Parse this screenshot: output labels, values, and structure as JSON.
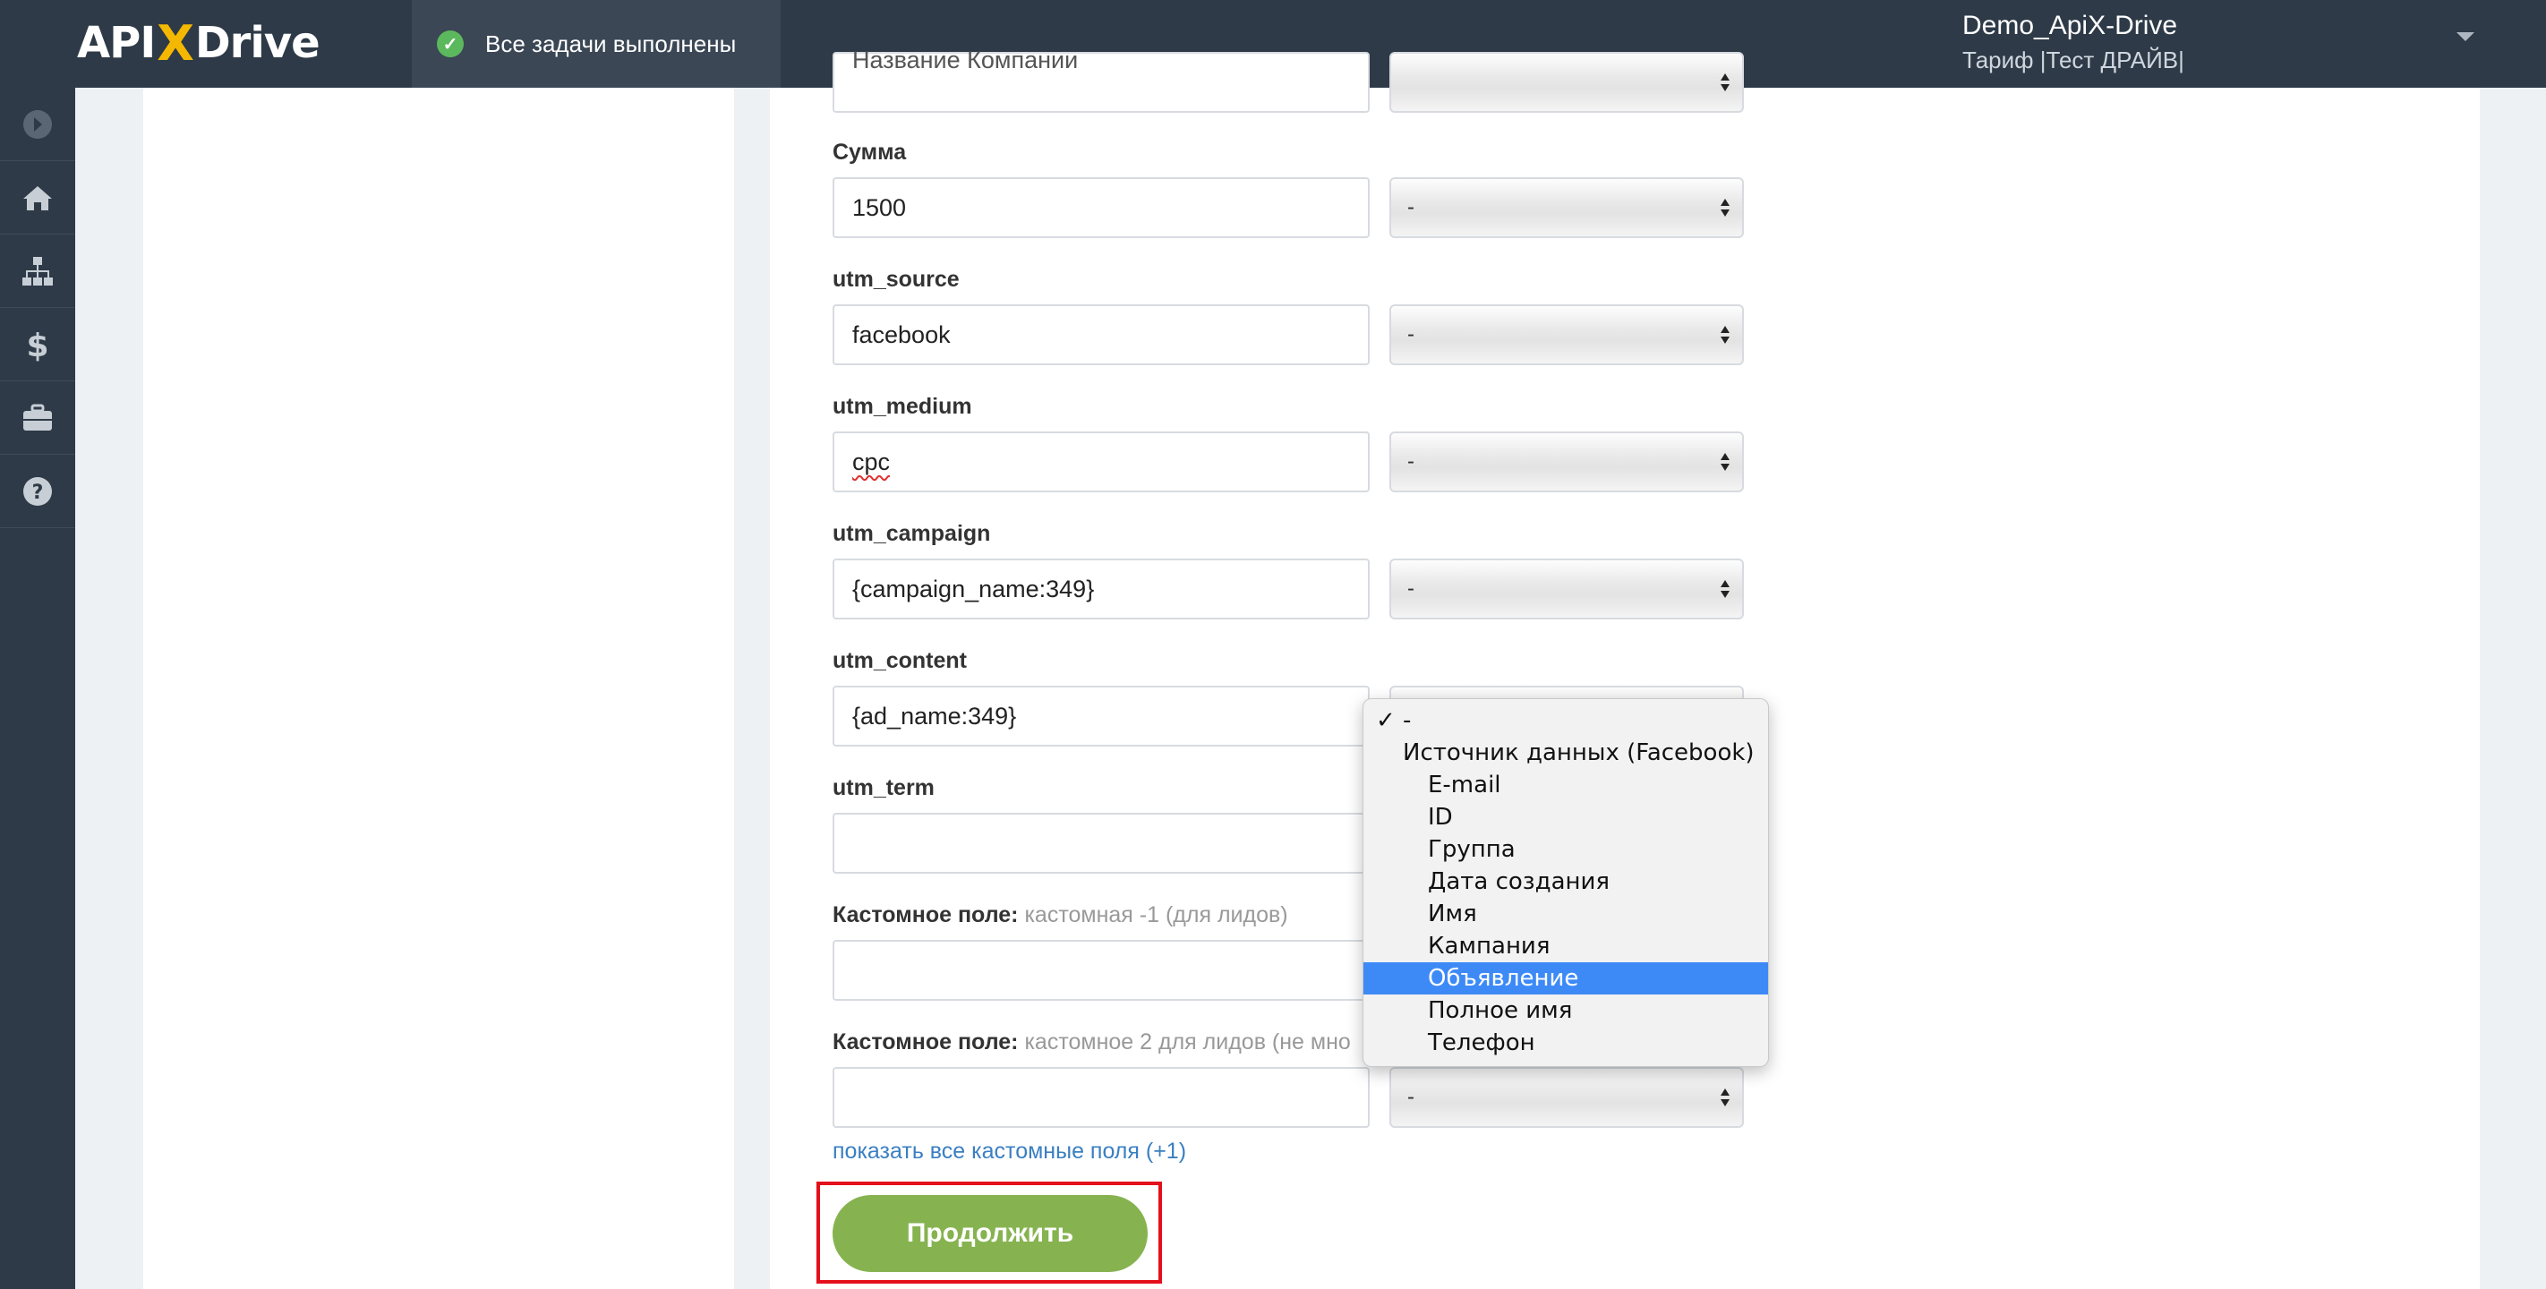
{
  "header": {
    "logo": {
      "left": "API",
      "x": "X",
      "right": "Drive"
    },
    "task_status": "Все задачи выполнены",
    "user_name": "Demo_ApiX-Drive",
    "user_plan": "Тариф |Тест ДРАЙВ|"
  },
  "sidebar": {
    "items": [
      {
        "icon": "arrow-circle-icon"
      },
      {
        "icon": "home-icon"
      },
      {
        "icon": "sitemap-icon"
      },
      {
        "icon": "dollar-icon"
      },
      {
        "icon": "briefcase-icon"
      },
      {
        "icon": "help-icon"
      }
    ]
  },
  "form": {
    "top_field_value": "Название Компании",
    "fields": [
      {
        "label": "Сумма",
        "value": "1500",
        "select": "-"
      },
      {
        "label": "utm_source",
        "value": "facebook",
        "select": "-"
      },
      {
        "label": "utm_medium",
        "value": "cpc",
        "select": "-"
      },
      {
        "label": "utm_campaign",
        "value": "{campaign_name:349}",
        "select": "-"
      },
      {
        "label": "utm_content",
        "value": "{ad_name:349}",
        "select": "-"
      },
      {
        "label": "utm_term",
        "value": "",
        "select": ""
      },
      {
        "label": "Кастомное поле:",
        "hint": "кастомная -1 (для лидов)",
        "value": "",
        "select": ""
      },
      {
        "label": "Кастомное поле:",
        "hint": "кастомное 2 для лидов (не мно",
        "value": "",
        "select": "-"
      }
    ],
    "show_all_link": "показать все кастомные поля (+1)",
    "continue_button": "Продолжить"
  },
  "dropdown": {
    "checked": "-",
    "group": "Источник данных (Facebook)",
    "options": [
      "E-mail",
      "ID",
      "Группа",
      "Дата создания",
      "Имя",
      "Кампания",
      "Объявление",
      "Полное имя",
      "Телефон"
    ],
    "highlighted": "Объявление"
  },
  "colors": {
    "topbar": "#2e3a47",
    "accent_green": "#86b350",
    "highlight_blue": "#3d8af7",
    "frame_red": "#e3101b",
    "link_blue": "#3a7fc1"
  }
}
